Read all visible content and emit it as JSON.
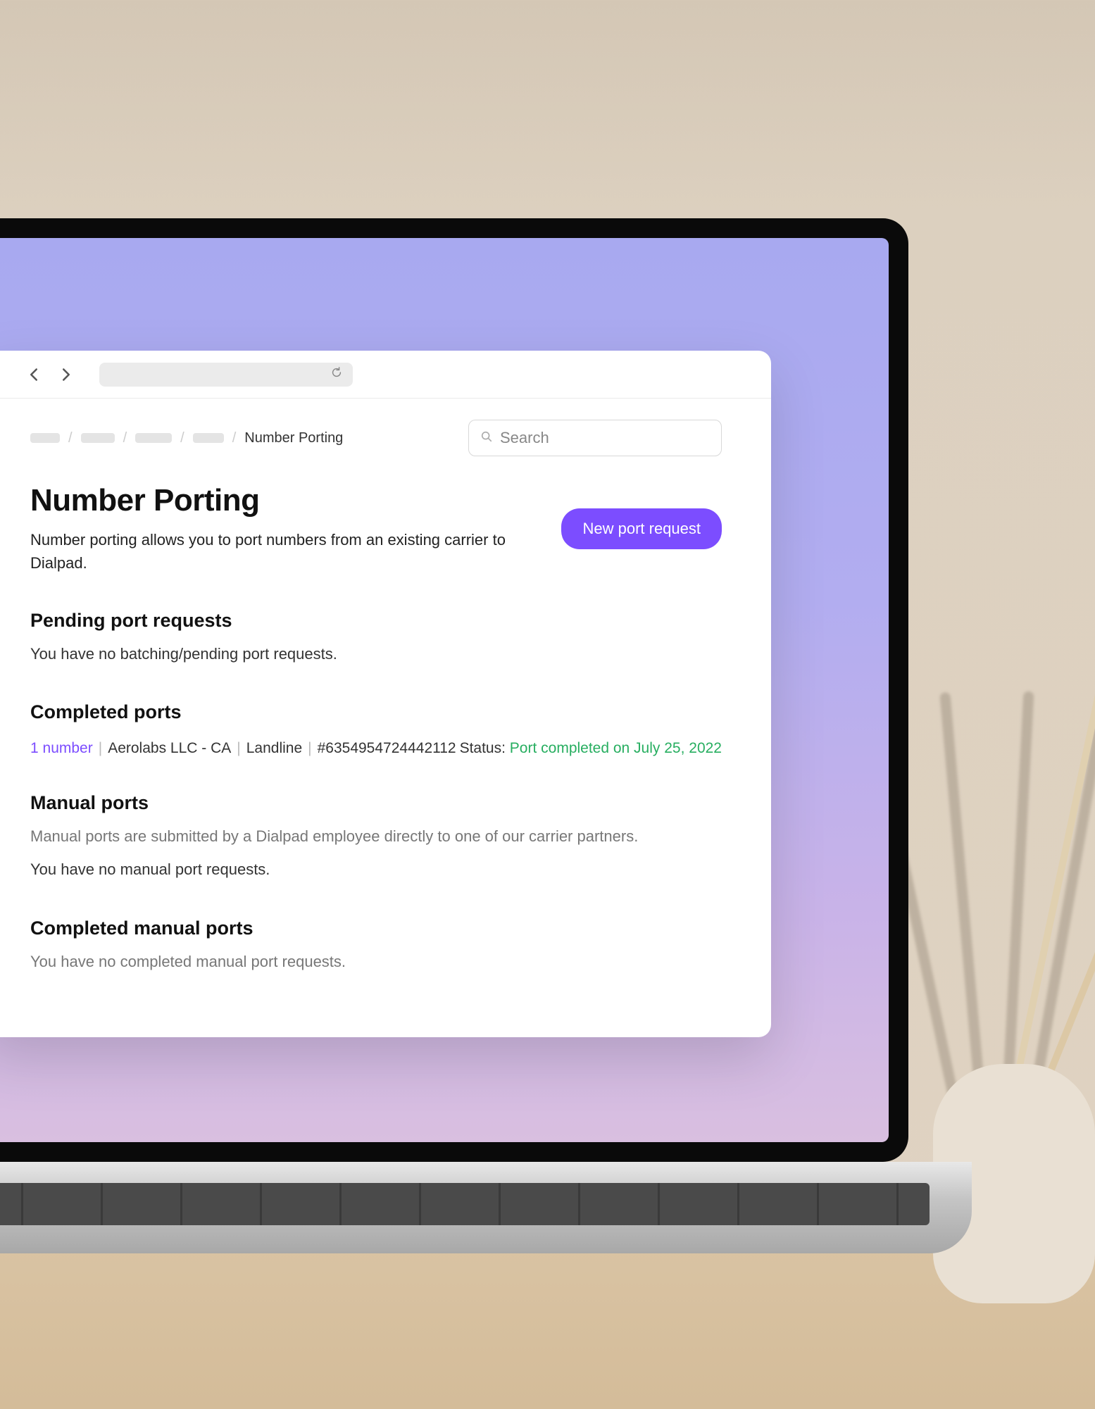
{
  "breadcrumb": {
    "current": "Number Porting"
  },
  "search": {
    "placeholder": "Search"
  },
  "page": {
    "title": "Number Porting",
    "subtitle": "Number porting allows you to port numbers from an existing carrier to Dialpad."
  },
  "actions": {
    "new_port_label": "New port request"
  },
  "sections": {
    "pending": {
      "title": "Pending port requests",
      "empty_text": "You have no batching/pending port requests."
    },
    "completed": {
      "title": "Completed ports",
      "item": {
        "number_link": "1 number",
        "account": "Aerolabs LLC - CA",
        "line_type": "Landline",
        "ref": "#6354954724442112",
        "status_label": "Status:",
        "status_value": "Port completed on July 25, 2022"
      }
    },
    "manual": {
      "title": "Manual ports",
      "description": "Manual ports are submitted by a Dialpad employee directly to one of our carrier partners.",
      "empty_text": "You have no manual port requests."
    },
    "completed_manual": {
      "title": "Completed manual ports",
      "empty_text": "You have no completed manual port requests."
    }
  }
}
